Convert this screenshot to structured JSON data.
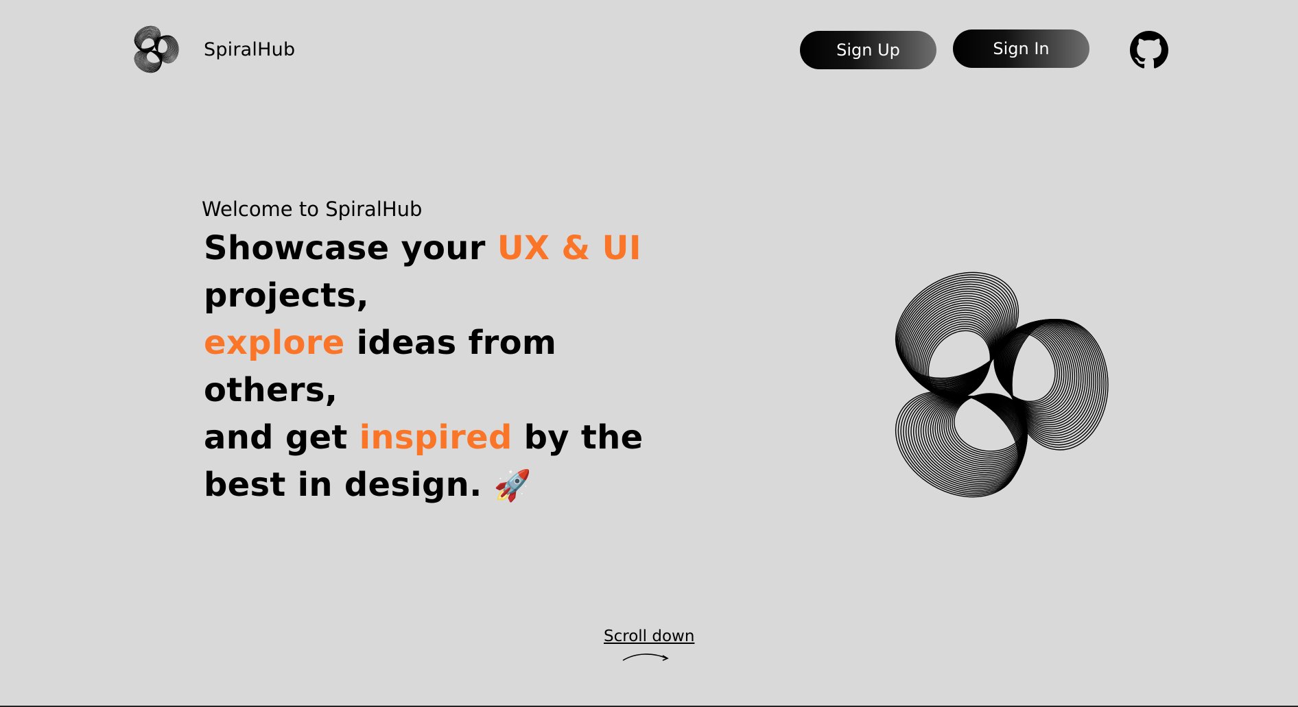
{
  "header": {
    "brand_name": "SpiralHub",
    "logo_icon": "spiral-logo-icon",
    "signup_label": "Sign Up",
    "signin_label": "Sign In",
    "github_icon": "github-icon"
  },
  "hero": {
    "welcome": "Welcome to SpiralHub",
    "line1_a": "Showcase your ",
    "line1_accent": "UX & UI",
    "line2": "projects,",
    "line3_accent": "explore",
    "line3_b": " ideas from",
    "line4": "others,",
    "line5_a": "and get ",
    "line5_accent": "inspired",
    "line5_b": " by the",
    "line6": "best in design.",
    "rocket": "🚀",
    "art_icon": "spiral-artwork-icon"
  },
  "scroll": {
    "label": "Scroll down",
    "arrow_icon": "curved-arrow-icon"
  },
  "colors": {
    "background": "#d9d9d9",
    "accent": "#fb7528",
    "text": "#000000"
  }
}
